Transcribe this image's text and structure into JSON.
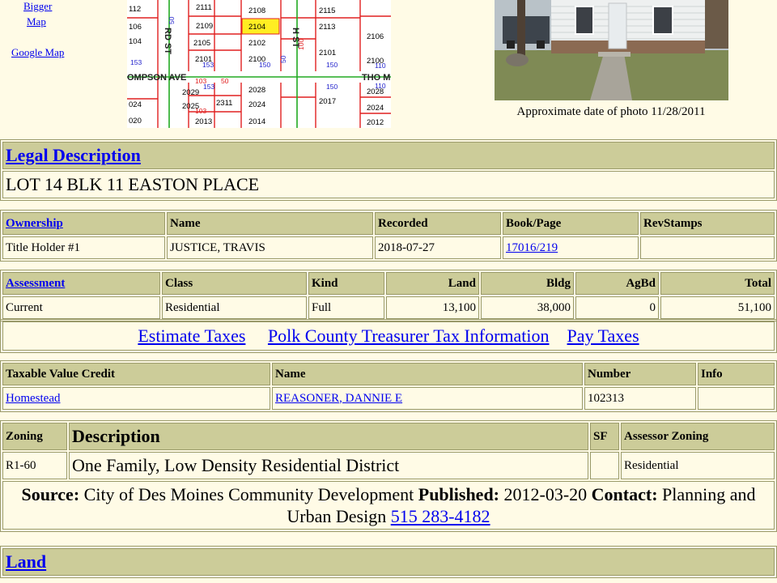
{
  "top_links": {
    "bigger_map": "Bigger",
    "map": "Map",
    "google_map": "Google Map"
  },
  "map": {
    "streets": {
      "third_st": "RD ST",
      "second_st": "H ST",
      "thompson_ave_left": "OMPSON AVE",
      "thompson_ave_right": "THO M"
    },
    "lots": {
      "r1": [
        "112",
        "2111",
        "2108",
        "2115"
      ],
      "r2": [
        "106",
        "2109",
        "2104",
        "2113",
        "2106"
      ],
      "r3": [
        "104",
        "2105",
        "2102",
        "2101"
      ],
      "r4": [
        "2101",
        "2100",
        "2100"
      ],
      "r5": [
        "2029",
        "2311",
        "2028",
        "2017",
        "2028"
      ],
      "r6": [
        "024",
        "2025",
        "2024",
        "2024"
      ],
      "r7": [
        "020",
        "2013",
        "2014",
        "2012"
      ],
      "measure": [
        "153",
        "153",
        "150",
        "150",
        "110",
        "103",
        "50",
        "153",
        "150",
        "110",
        "103",
        "50",
        "100",
        "50"
      ]
    }
  },
  "photo": {
    "caption": "Approximate date of photo 11/28/2011"
  },
  "legal": {
    "header": "Legal Description",
    "text": "LOT 14 BLK 11 EASTON PLACE"
  },
  "ownership": {
    "headers": [
      "Ownership",
      "Name",
      "Recorded",
      "Book/Page",
      "RevStamps"
    ],
    "row": [
      "Title Holder #1",
      "JUSTICE, TRAVIS",
      "2018-07-27",
      "17016/219",
      ""
    ]
  },
  "assessment": {
    "headers": [
      "Assessment",
      "Class",
      "Kind",
      "Land",
      "Bldg",
      "AgBd",
      "Total"
    ],
    "row": [
      "Current",
      "Residential",
      "Full",
      "13,100",
      "38,000",
      "0",
      "51,100"
    ]
  },
  "tax_links": {
    "estimate": "Estimate Taxes",
    "treasurer": "Polk County Treasurer Tax Information",
    "pay": "Pay Taxes"
  },
  "credit": {
    "headers": [
      "Taxable Value Credit",
      "Name",
      "Number",
      "Info"
    ],
    "row": [
      "Homestead",
      "REASONER, DANNIE E",
      "102313",
      ""
    ]
  },
  "zoning": {
    "headers": [
      "Zoning",
      "Description",
      "SF",
      "Assessor Zoning"
    ],
    "row": [
      "R1-60",
      "One Family, Low Density Residential District",
      "",
      "Residential"
    ],
    "source_label": "Source:",
    "source_value": "City of Des Moines Community Development",
    "published_label": "Published:",
    "published_value": "2012-03-20",
    "contact_label": "Contact:",
    "contact_value": "Planning and Urban Design",
    "phone": "515 283-4182"
  },
  "land": {
    "header": "Land"
  }
}
